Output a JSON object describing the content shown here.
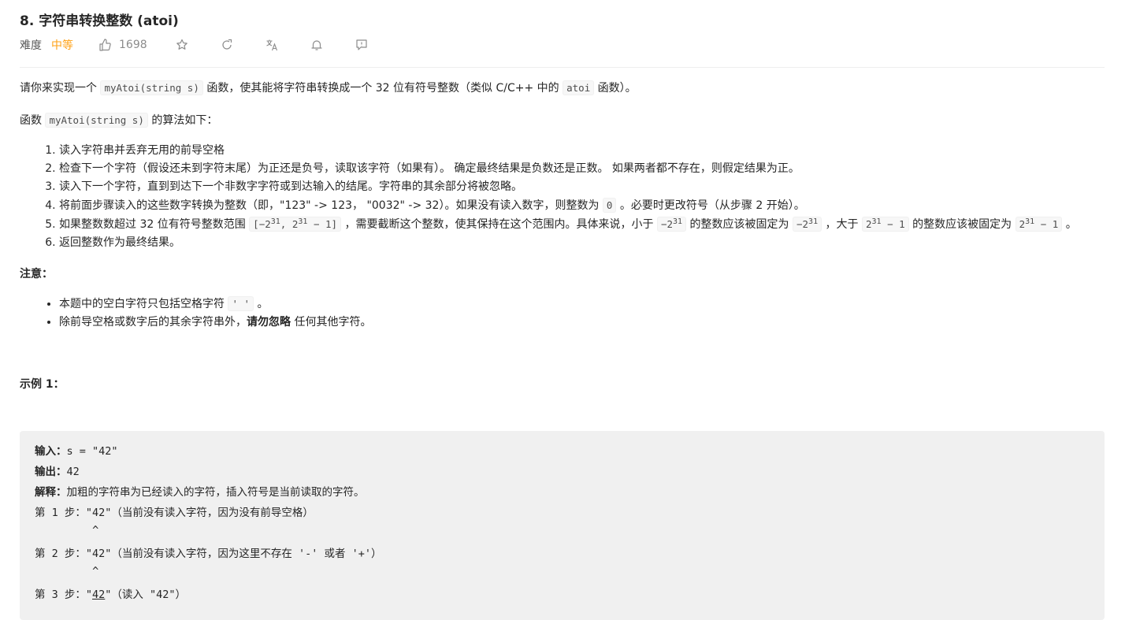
{
  "problem": {
    "title": "8. 字符串转换整数 (atoi)",
    "difficulty_label": "难度",
    "difficulty": "中等",
    "likes": "1698",
    "colors": {
      "difficulty": "#ffa116",
      "text": "#262626",
      "muted": "#8c8c8c"
    }
  },
  "toolbar": {
    "icons": [
      "thumbs-up-icon",
      "star-icon",
      "share-icon",
      "translate-icon",
      "bell-icon",
      "comment-icon"
    ]
  },
  "description": {
    "p1_a": "请你来实现一个 ",
    "p1_code": "myAtoi(string s)",
    "p1_b": " 函数，使其能将字符串转换成一个 32 位有符号整数（类似 C/C++ 中的 ",
    "p1_code2": "atoi",
    "p1_c": " 函数）。",
    "p2_a": "函数 ",
    "p2_code": "myAtoi(string s)",
    "p2_b": " 的算法如下：",
    "steps": {
      "s1": "读入字符串并丢弃无用的前导空格",
      "s2": "检查下一个字符（假设还未到字符末尾）为正还是负号，读取该字符（如果有）。 确定最终结果是负数还是正数。 如果两者都不存在，则假定结果为正。",
      "s3": "读入下一个字符，直到到达下一个非数字字符或到达输入的结尾。字符串的其余部分将被忽略。",
      "s4_a": "将前面步骤读入的这些数字转换为整数（即，\"123\" -> 123， \"0032\" -> 32）。如果没有读入数字，则整数为 ",
      "s4_code": "0",
      "s4_b": " 。必要时更改符号（从步骤 2 开始）。",
      "s5_a": "如果整数数超过 32 位有符号整数范围 ",
      "s5_r1": "[−2",
      "s5_r_exp": "31",
      "s5_r2": ",  2",
      "s5_r3": " − 1]",
      "s5_b": " ，需要截断这个整数，使其保持在这个范围内。具体来说，小于 ",
      "s5_c1": "−2",
      "s5_c": " 的整数应该被固定为 ",
      "s5_d": " ，大于 ",
      "s5_d1": "2",
      "s5_d2": " − 1",
      "s5_e": " 的整数应该被固定为 ",
      "s5_f": " 。",
      "s6": "返回整数作为最终结果。"
    },
    "note_title": "注意：",
    "notes": {
      "n1_a": "本题中的空白字符只包括空格字符 ",
      "n1_code": "' '",
      "n1_b": " 。",
      "n2_a": "除前导空格或数字后的其余字符串外，",
      "n2_bold": "请勿忽略",
      "n2_b": " 任何其他字符。"
    },
    "example_title": "示例 1："
  },
  "example": {
    "input_label": "输入：",
    "input_value": "s = \"42\"",
    "output_label": "输出：",
    "output_value": "42",
    "explain_label": "解释：",
    "explain_value": "加粗的字符串为已经读入的字符，插入符号是当前读取的字符。",
    "step1": "第 1 步：\"42\"（当前没有读入字符，因为没有前导空格）",
    "caret1": "         ^",
    "step2": "第 2 步：\"42\"（当前没有读入字符，因为这里不存在 '-' 或者 '+'）",
    "caret2": "         ^",
    "step3_a": "第 3 步：\"",
    "step3_u": "42",
    "step3_b": "\"（读入 \"42\"）"
  }
}
